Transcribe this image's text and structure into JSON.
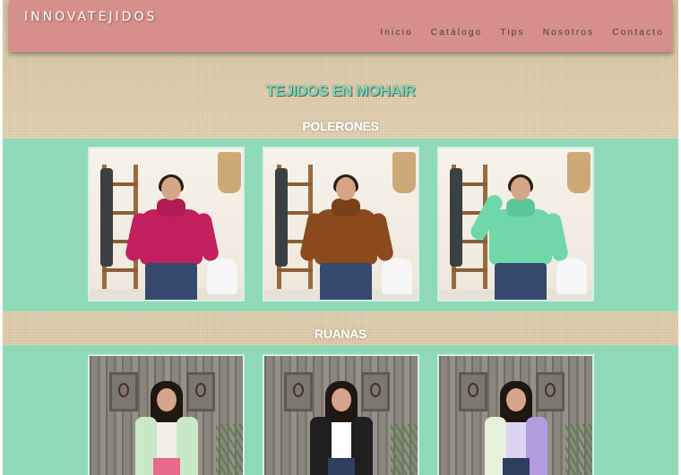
{
  "site": {
    "brand": "INNOVATEJIDOS"
  },
  "nav": {
    "items": [
      {
        "label": "Inicio"
      },
      {
        "label": "Catálogo"
      },
      {
        "label": "Tips"
      },
      {
        "label": "Nosotros"
      },
      {
        "label": "Contacto"
      }
    ]
  },
  "page": {
    "title": "TEJIDOS EN MOHAIR"
  },
  "sections": [
    {
      "title": "POLERONES",
      "products": [
        {
          "color_name": "fuchsia",
          "color": "#c21f5e"
        },
        {
          "color_name": "caramel",
          "color": "#8a4a1e"
        },
        {
          "color_name": "mint",
          "color": "#6fd7a8"
        }
      ]
    },
    {
      "title": "RUANAS",
      "products": [
        {
          "color_name": "mint-pink",
          "color": "#c9e8c8",
          "accent": "#e86a8c"
        },
        {
          "color_name": "black-cream",
          "color": "#1f1f1f",
          "accent": "#efe6cf"
        },
        {
          "color_name": "lilac",
          "color": "#b39be0",
          "accent": "#d4c6f2"
        }
      ]
    }
  ],
  "colors": {
    "navbar": "#d68f8a",
    "band": "#8dd9b8",
    "title": "#7fd3b4"
  }
}
